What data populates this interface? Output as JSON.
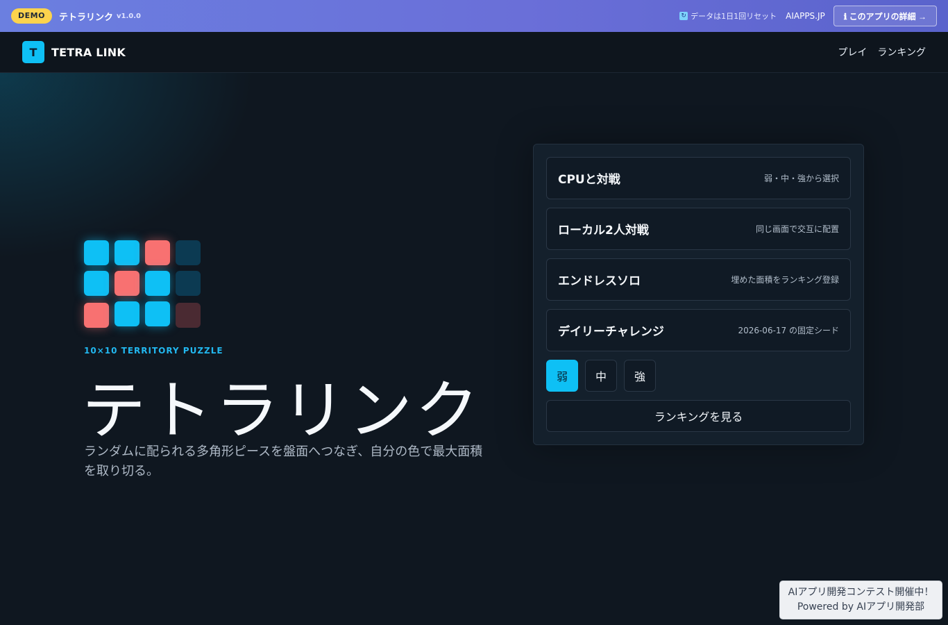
{
  "demo_bar": {
    "badge": "DEMO",
    "app_name": "テトラリンク",
    "version": "v1.0.0",
    "reset_note": "データは1日1回リセット",
    "site": "AIAPPS.JP",
    "detail_button": "ℹ このアプリの詳細 →"
  },
  "nav": {
    "logo_letter": "T",
    "logo_text": "TETRA LINK",
    "links": [
      "プレイ",
      "ランキング"
    ]
  },
  "hero": {
    "eyebrow": "10×10 TERRITORY PUZZLE",
    "title": "テトラリンク",
    "description": "ランダムに配られる多角形ピースを盤面へつなぎ、自分の色で最大面積を取り切る。"
  },
  "colors": {
    "accent_cyan": "#0ec0f5",
    "accent_red": "#f87171",
    "demo_badge": "#fcd34d"
  },
  "modes": [
    {
      "title": "CPUと対戦",
      "subtitle": "弱・中・強から選択"
    },
    {
      "title": "ローカル2人対戦",
      "subtitle": "同じ画面で交互に配置"
    },
    {
      "title": "エンドレスソロ",
      "subtitle": "埋めた面積をランキング登録"
    },
    {
      "title": "デイリーチャレンジ",
      "subtitle": "2026-06-17 の固定シード"
    }
  ],
  "difficulty": {
    "options": [
      "弱",
      "中",
      "強"
    ],
    "selected": "弱"
  },
  "ranking_button": "ランキングを見る",
  "contest": {
    "line1": "AIアプリ開発コンテスト開催中！",
    "line2": "Powered by AIアプリ開発部"
  }
}
